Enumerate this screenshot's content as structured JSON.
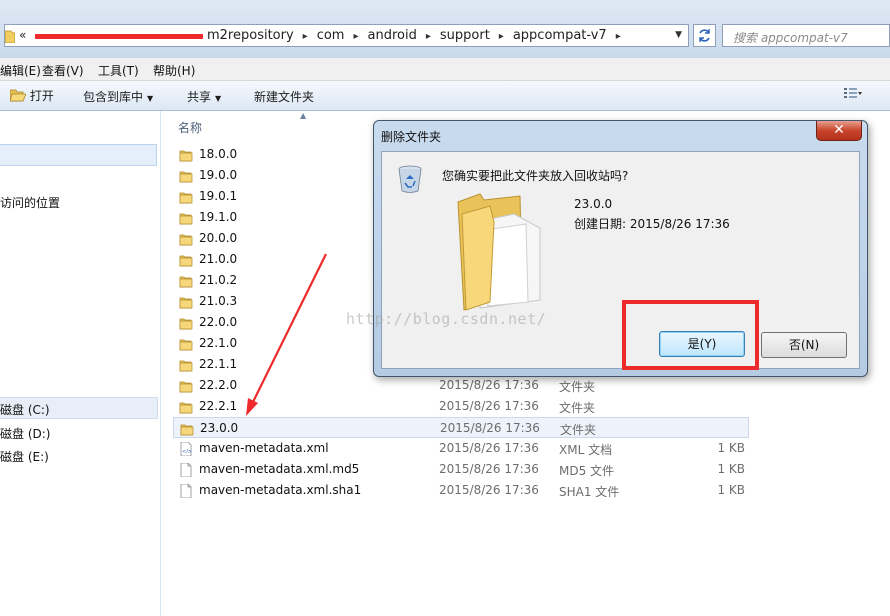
{
  "address_bar": {
    "prefix": "«",
    "breadcrumbs": [
      "m2repository",
      "com",
      "android",
      "support",
      "appcompat-v7"
    ],
    "search_placeholder": "搜索 appcompat-v7"
  },
  "menu": [
    "编辑(E)",
    "查看(V)",
    "工具(T)",
    "帮助(H)"
  ],
  "toolbar": {
    "open": "打开",
    "include_in_library": "包含到库中",
    "share": "共享",
    "new_folder": "新建文件夹"
  },
  "nav": {
    "recent_places": "访问的位置",
    "drives": [
      "磁盘 (C:)",
      "磁盘 (D:)",
      "磁盘 (E:)"
    ]
  },
  "file_list": {
    "column_name": "名称",
    "rows": [
      {
        "name": "18.0.0",
        "kind": "folder",
        "date": "",
        "type": "",
        "size": ""
      },
      {
        "name": "19.0.0",
        "kind": "folder",
        "date": "",
        "type": "",
        "size": ""
      },
      {
        "name": "19.0.1",
        "kind": "folder",
        "date": "",
        "type": "",
        "size": ""
      },
      {
        "name": "19.1.0",
        "kind": "folder",
        "date": "",
        "type": "",
        "size": ""
      },
      {
        "name": "20.0.0",
        "kind": "folder",
        "date": "",
        "type": "",
        "size": ""
      },
      {
        "name": "21.0.0",
        "kind": "folder",
        "date": "",
        "type": "",
        "size": ""
      },
      {
        "name": "21.0.2",
        "kind": "folder",
        "date": "",
        "type": "",
        "size": ""
      },
      {
        "name": "21.0.3",
        "kind": "folder",
        "date": "",
        "type": "",
        "size": ""
      },
      {
        "name": "22.0.0",
        "kind": "folder",
        "date": "",
        "type": "",
        "size": ""
      },
      {
        "name": "22.1.0",
        "kind": "folder",
        "date": "",
        "type": "",
        "size": ""
      },
      {
        "name": "22.1.1",
        "kind": "folder",
        "date": "",
        "type": "",
        "size": ""
      },
      {
        "name": "22.2.0",
        "kind": "folder",
        "date": "2015/8/26 17:36",
        "type": "文件夹",
        "size": ""
      },
      {
        "name": "22.2.1",
        "kind": "folder",
        "date": "2015/8/26 17:36",
        "type": "文件夹",
        "size": ""
      },
      {
        "name": "23.0.0",
        "kind": "folder",
        "date": "2015/8/26 17:36",
        "type": "文件夹",
        "size": "",
        "selected": true
      },
      {
        "name": "maven-metadata.xml",
        "kind": "xml",
        "date": "2015/8/26 17:36",
        "type": "XML 文档",
        "size": "1 KB"
      },
      {
        "name": "maven-metadata.xml.md5",
        "kind": "file",
        "date": "2015/8/26 17:36",
        "type": "MD5 文件",
        "size": "1 KB"
      },
      {
        "name": "maven-metadata.xml.sha1",
        "kind": "file",
        "date": "2015/8/26 17:36",
        "type": "SHA1 文件",
        "size": "1 KB"
      }
    ]
  },
  "dialog": {
    "title": "删除文件夹",
    "close_label": "✕",
    "question": "您确实要把此文件夹放入回收站吗?",
    "folder_name": "23.0.0",
    "created_date": "创建日期: 2015/8/26 17:36",
    "yes_label": "是(Y)",
    "no_label": "否(N)"
  },
  "watermark": "http://blog.csdn.net/",
  "colors": {
    "annotation_red": "#ee2a2a",
    "folder_yellow": "#f2cd5f"
  }
}
